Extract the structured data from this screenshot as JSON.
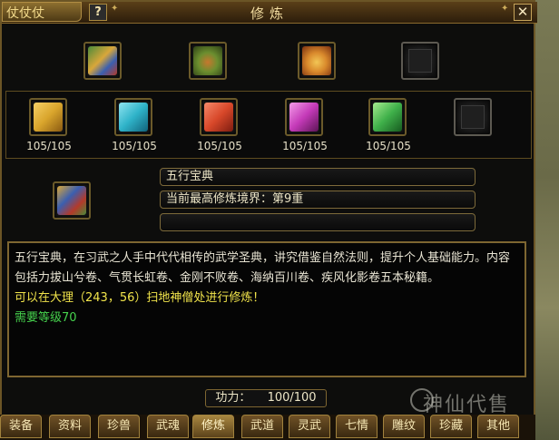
{
  "window": {
    "title": "修炼",
    "left_title": "仗仗仗",
    "help_label": "?",
    "close_label": "✕"
  },
  "top_items": [
    {
      "name": "scripture-scroll-icon",
      "color_a": "#5d9a3a",
      "color_b": "#d9a73a"
    },
    {
      "name": "treasure-chest-green-icon",
      "color_a": "#6b8e2f",
      "color_b": "#b4622a"
    },
    {
      "name": "treasure-chest-gold-icon",
      "color_a": "#c9762c",
      "color_b": "#f2c655"
    },
    {
      "name": "empty-slot-icon"
    }
  ],
  "books": [
    {
      "name": "yellow-book-icon",
      "color": "#d9a52c",
      "count": "105/105"
    },
    {
      "name": "cyan-book-icon",
      "color": "#2fb3c9",
      "count": "105/105"
    },
    {
      "name": "red-book-icon",
      "color": "#d8482a",
      "count": "105/105"
    },
    {
      "name": "magenta-book-icon",
      "color": "#c43ab8",
      "count": "105/105"
    },
    {
      "name": "green-book-icon",
      "color": "#3fb04a",
      "count": "105/105"
    },
    {
      "name": "empty-book-slot-icon"
    }
  ],
  "selected": {
    "name_field": "五行宝典",
    "realm_field": "当前最高修炼境界：第9重",
    "extra_field": ""
  },
  "description": {
    "body": "五行宝典，在习武之人手中代代相传的武学圣典，讲究借鉴自然法则，提升个人基础能力。内容包括力拔山兮卷、气贯长虹卷、金刚不败卷、海纳百川卷、疾风化影卷五本秘籍。",
    "location": "可以在大理（243，56）扫地神僧处进行修炼！",
    "level": "需要等级70"
  },
  "power": {
    "label": "功力：",
    "value": "100/100"
  },
  "tabs": [
    "装备",
    "资料",
    "珍兽",
    "武魂",
    "修炼",
    "武道",
    "灵武",
    "七情",
    "雕纹",
    "珍藏",
    "其他"
  ],
  "active_tab": "修炼",
  "watermark": "神仙代售"
}
